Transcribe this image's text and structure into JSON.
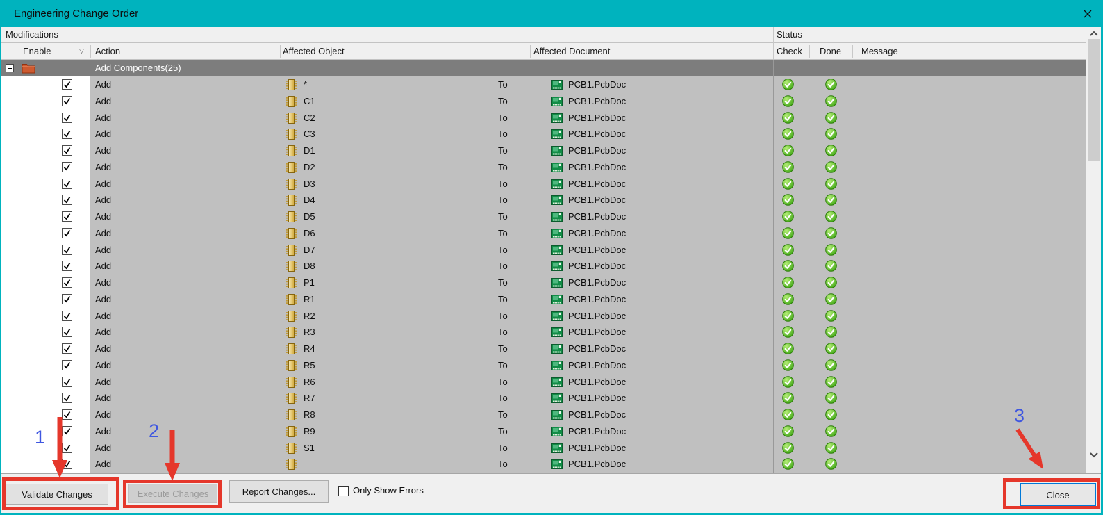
{
  "title_bar": {
    "title": "Engineering Change Order",
    "close_icon": "✕"
  },
  "panel_headers": {
    "modifications": "Modifications",
    "status": "Status"
  },
  "columns": {
    "enable": "Enable",
    "sort_icon": "▽",
    "action": "Action",
    "affected_object": "Affected Object",
    "affected_document": "Affected Document",
    "check": "Check",
    "done": "Done",
    "message": "Message"
  },
  "group_row": {
    "label": "Add Components(25)",
    "collapse_icon": "minus-box",
    "folder_icon": "orange-folder"
  },
  "icons": {
    "component_icon": "gold-chip",
    "document_icon": "green-pcb-document",
    "status_icon": "green-circle-white-check",
    "checkbox_icon": "black-check",
    "scroll_up_icon": "chevron-up",
    "scroll_down_icon": "chevron-down"
  },
  "rows": [
    {
      "action": "Add",
      "object": "*",
      "to": "To",
      "document": "PCB1.PcbDoc",
      "check": true,
      "done": true,
      "message": ""
    },
    {
      "action": "Add",
      "object": "C1",
      "to": "To",
      "document": "PCB1.PcbDoc",
      "check": true,
      "done": true,
      "message": ""
    },
    {
      "action": "Add",
      "object": "C2",
      "to": "To",
      "document": "PCB1.PcbDoc",
      "check": true,
      "done": true,
      "message": ""
    },
    {
      "action": "Add",
      "object": "C3",
      "to": "To",
      "document": "PCB1.PcbDoc",
      "check": true,
      "done": true,
      "message": ""
    },
    {
      "action": "Add",
      "object": "D1",
      "to": "To",
      "document": "PCB1.PcbDoc",
      "check": true,
      "done": true,
      "message": ""
    },
    {
      "action": "Add",
      "object": "D2",
      "to": "To",
      "document": "PCB1.PcbDoc",
      "check": true,
      "done": true,
      "message": ""
    },
    {
      "action": "Add",
      "object": "D3",
      "to": "To",
      "document": "PCB1.PcbDoc",
      "check": true,
      "done": true,
      "message": ""
    },
    {
      "action": "Add",
      "object": "D4",
      "to": "To",
      "document": "PCB1.PcbDoc",
      "check": true,
      "done": true,
      "message": ""
    },
    {
      "action": "Add",
      "object": "D5",
      "to": "To",
      "document": "PCB1.PcbDoc",
      "check": true,
      "done": true,
      "message": ""
    },
    {
      "action": "Add",
      "object": "D6",
      "to": "To",
      "document": "PCB1.PcbDoc",
      "check": true,
      "done": true,
      "message": ""
    },
    {
      "action": "Add",
      "object": "D7",
      "to": "To",
      "document": "PCB1.PcbDoc",
      "check": true,
      "done": true,
      "message": ""
    },
    {
      "action": "Add",
      "object": "D8",
      "to": "To",
      "document": "PCB1.PcbDoc",
      "check": true,
      "done": true,
      "message": ""
    },
    {
      "action": "Add",
      "object": "P1",
      "to": "To",
      "document": "PCB1.PcbDoc",
      "check": true,
      "done": true,
      "message": ""
    },
    {
      "action": "Add",
      "object": "R1",
      "to": "To",
      "document": "PCB1.PcbDoc",
      "check": true,
      "done": true,
      "message": ""
    },
    {
      "action": "Add",
      "object": "R2",
      "to": "To",
      "document": "PCB1.PcbDoc",
      "check": true,
      "done": true,
      "message": ""
    },
    {
      "action": "Add",
      "object": "R3",
      "to": "To",
      "document": "PCB1.PcbDoc",
      "check": true,
      "done": true,
      "message": ""
    },
    {
      "action": "Add",
      "object": "R4",
      "to": "To",
      "document": "PCB1.PcbDoc",
      "check": true,
      "done": true,
      "message": ""
    },
    {
      "action": "Add",
      "object": "R5",
      "to": "To",
      "document": "PCB1.PcbDoc",
      "check": true,
      "done": true,
      "message": ""
    },
    {
      "action": "Add",
      "object": "R6",
      "to": "To",
      "document": "PCB1.PcbDoc",
      "check": true,
      "done": true,
      "message": ""
    },
    {
      "action": "Add",
      "object": "R7",
      "to": "To",
      "document": "PCB1.PcbDoc",
      "check": true,
      "done": true,
      "message": ""
    },
    {
      "action": "Add",
      "object": "R8",
      "to": "To",
      "document": "PCB1.PcbDoc",
      "check": true,
      "done": true,
      "message": ""
    },
    {
      "action": "Add",
      "object": "R9",
      "to": "To",
      "document": "PCB1.PcbDoc",
      "check": true,
      "done": true,
      "message": ""
    },
    {
      "action": "Add",
      "object": "S1",
      "to": "To",
      "document": "PCB1.PcbDoc",
      "check": true,
      "done": true,
      "message": ""
    },
    {
      "action": "Add",
      "object": "",
      "to": "To",
      "document": "PCB1.PcbDoc",
      "check": true,
      "done": true,
      "message": ""
    }
  ],
  "footer": {
    "validate_label": "Validate Changes",
    "execute_label": "Execute Changes",
    "report_prefix": "R",
    "report_rest": "eport Changes...",
    "only_show_errors_label": "Only Show Errors",
    "only_show_errors_checked": false,
    "close_label": "Close"
  },
  "annotations": {
    "n1": "1",
    "n2": "2",
    "n3": "3"
  },
  "colors": {
    "titlebar_teal": "#00b3be",
    "row_gray": "#c0c0c0",
    "group_gray": "#7d7d7d",
    "annotation_red": "#e5372b",
    "annotation_blue": "#3f57e0",
    "status_green": "#35a00c",
    "component_gold": "#d4ab3c",
    "document_green": "#118c46",
    "folder_orange": "#cd5a30",
    "focus_blue": "#0078d7"
  }
}
